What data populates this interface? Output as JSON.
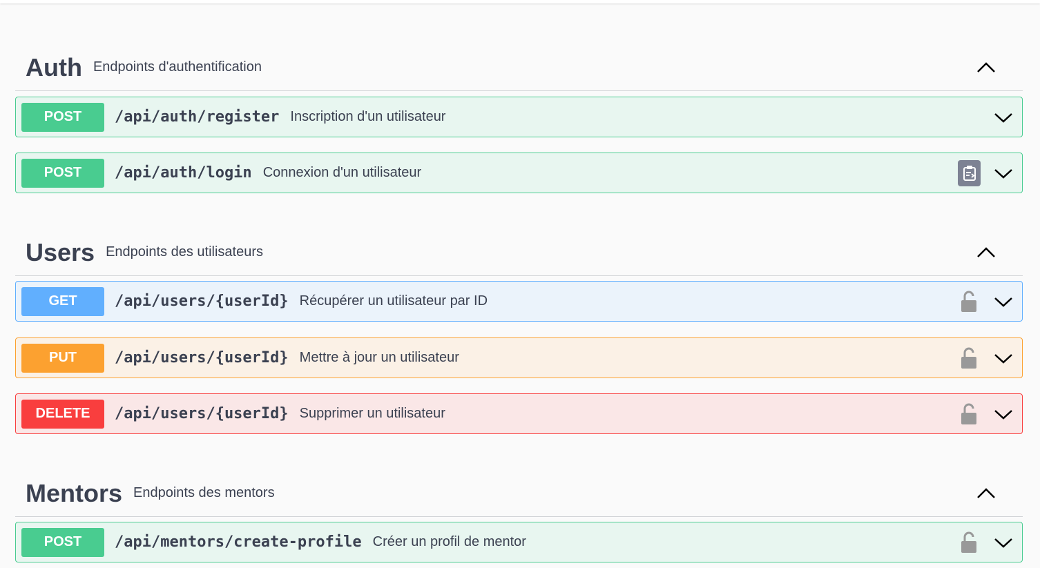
{
  "sections": [
    {
      "name": "Auth",
      "description": "Endpoints d'authentification",
      "operations": [
        {
          "method": "POST",
          "path": "/api/auth/register",
          "summary": "Inscription d'un utilisateur"
        },
        {
          "method": "POST",
          "path": "/api/auth/login",
          "summary": "Connexion d'un utilisateur",
          "icon": "copy-to-clipboard-icon"
        }
      ]
    },
    {
      "name": "Users",
      "description": "Endpoints des utilisateurs",
      "operations": [
        {
          "method": "GET",
          "path": "/api/users/{userId}",
          "summary": "Récupérer un utilisateur par ID",
          "icon": "lock-icon"
        },
        {
          "method": "PUT",
          "path": "/api/users/{userId}",
          "summary": "Mettre à jour un utilisateur",
          "icon": "lock-icon"
        },
        {
          "method": "DELETE",
          "path": "/api/users/{userId}",
          "summary": "Supprimer un utilisateur",
          "icon": "lock-icon"
        }
      ]
    },
    {
      "name": "Mentors",
      "description": "Endpoints des mentors",
      "operations": [
        {
          "method": "POST",
          "path": "/api/mentors/create-profile",
          "summary": "Créer un profil de mentor",
          "icon": "lock-icon"
        }
      ]
    }
  ],
  "colors": {
    "post": "#49cc90",
    "get": "#61affe",
    "put": "#fca130",
    "delete": "#f93e3e"
  }
}
